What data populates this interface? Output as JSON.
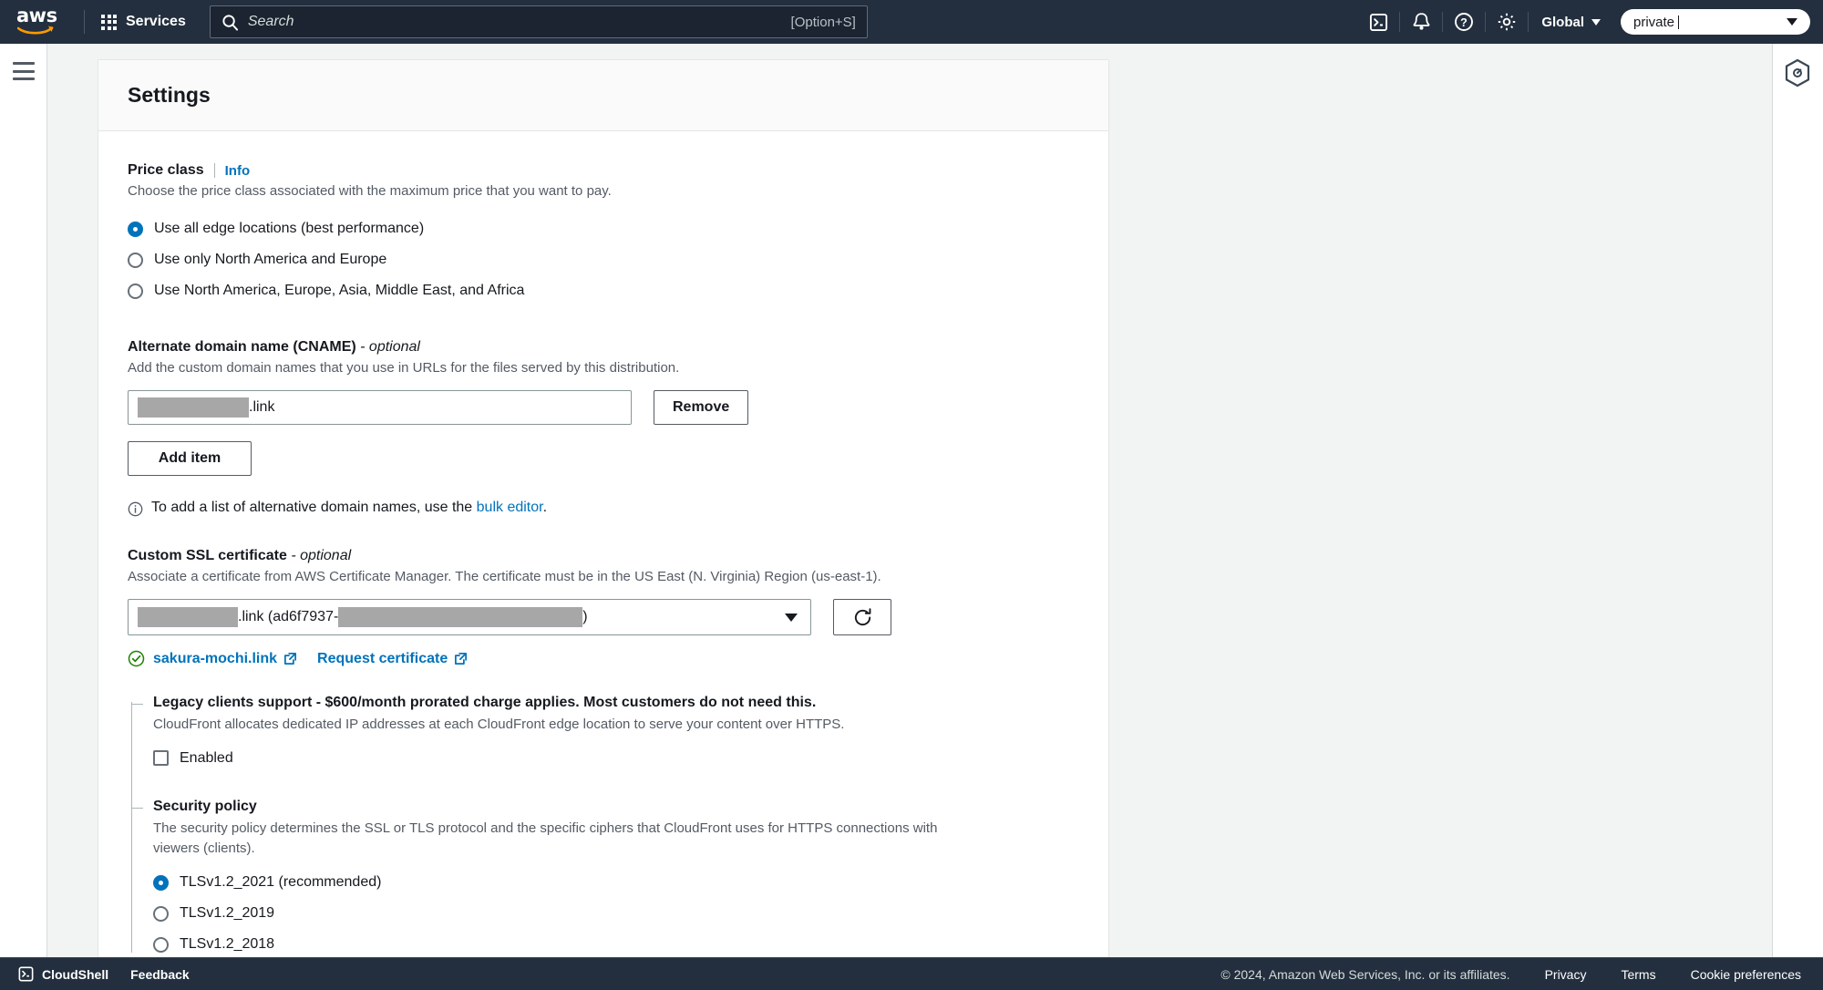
{
  "topnav": {
    "logo_text": "aws",
    "logo_name": "aws-logo",
    "services_label": "Services",
    "search": {
      "placeholder": "Search",
      "value": "",
      "shortcut_hint": "[Option+S]",
      "icon": "search-icon"
    },
    "icons": [
      {
        "name": "cloudshell-icon",
        "title": "CloudShell"
      },
      {
        "name": "notifications-bell-icon",
        "title": "Notifications"
      },
      {
        "name": "help-question-icon",
        "title": "Help"
      },
      {
        "name": "settings-gear-icon",
        "title": "Settings"
      }
    ],
    "region_label": "Global",
    "account_value": "private",
    "account_caret_icon": "chevron-down-icon"
  },
  "left_rail": {
    "menu_icon": "hamburger-menu-icon"
  },
  "right_rail": {
    "panel_icon": "cloudfront-hex-icon"
  },
  "card": {
    "title": "Settings"
  },
  "price_class": {
    "label": "Price class",
    "info_label": "Info",
    "description": "Choose the price class associated with the maximum price that you want to pay.",
    "options": [
      {
        "label": "Use all edge locations (best performance)",
        "selected": true
      },
      {
        "label": "Use only North America and Europe",
        "selected": false
      },
      {
        "label": "Use North America, Europe, Asia, Middle East, and Africa",
        "selected": false
      }
    ]
  },
  "cname": {
    "label": "Alternate domain name (CNAME)",
    "optional_suffix": "- optional",
    "description": "Add the custom domain names that you use in URLs for the files served by this distribution.",
    "value_redacted": true,
    "value_suffix": ".link",
    "remove_label": "Remove",
    "add_item_label": "Add item",
    "hint_prefix": "To add a list of alternative domain names, use the ",
    "hint_link": "bulk editor",
    "hint_suffix": ".",
    "info_icon": "info-circle-icon"
  },
  "ssl": {
    "label": "Custom SSL certificate",
    "optional_suffix": "- optional",
    "description": "Associate a certificate from AWS Certificate Manager. The certificate must be in the US East (N. Virginia) Region (us-east-1).",
    "selected_prefix_redacted": true,
    "selected_mid": ".link (ad6f7937-",
    "selected_suffix": ")",
    "refresh_icon": "refresh-icon",
    "caret_icon": "chevron-down-icon",
    "cert_link_label": "sakura-mochi.link",
    "cert_status_icon": "check-circle-icon",
    "request_cert_label": "Request certificate",
    "external_icon": "external-link-icon"
  },
  "legacy": {
    "title": "Legacy clients support - $600/month prorated charge applies. Most customers do not need this.",
    "description": "CloudFront allocates dedicated IP addresses at each CloudFront edge location to serve your content over HTTPS.",
    "checkbox_label": "Enabled",
    "checked": false
  },
  "security_policy": {
    "title": "Security policy",
    "description": "The security policy determines the SSL or TLS protocol and the specific ciphers that CloudFront uses for HTTPS connections with viewers (clients).",
    "options": [
      {
        "label": "TLSv1.2_2021 (recommended)",
        "selected": true
      },
      {
        "label": "TLSv1.2_2019",
        "selected": false
      },
      {
        "label": "TLSv1.2_2018",
        "selected": false
      }
    ]
  },
  "footer": {
    "cloudshell_label": "CloudShell",
    "cloudshell_icon": "cloudshell-icon",
    "feedback_label": "Feedback",
    "copyright": "© 2024, Amazon Web Services, Inc. or its affiliates.",
    "privacy_label": "Privacy",
    "terms_label": "Terms",
    "cookie_label": "Cookie preferences"
  },
  "colors": {
    "nav_bg": "#232f3e",
    "link_blue": "#0073bb",
    "page_bg": "#f2f3f3",
    "text": "#16191f",
    "muted": "#545b64",
    "success_green": "#1d8102"
  }
}
